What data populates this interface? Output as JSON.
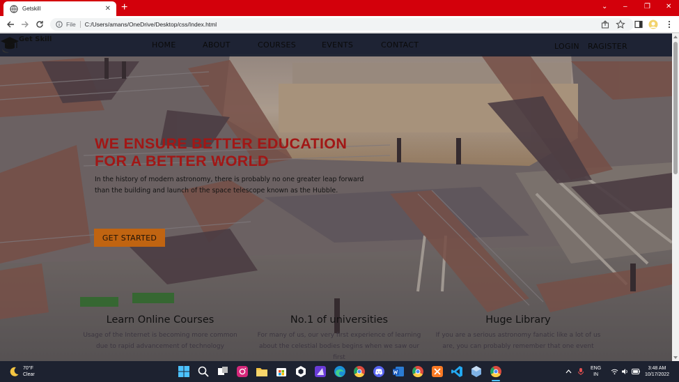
{
  "browser": {
    "tab_title": "Getskill",
    "tab_close": "✕",
    "new_tab": "+",
    "minimize": "⌄",
    "window_min": "–",
    "window_max": "❐",
    "window_close": "✕",
    "url_scheme": "File",
    "url": "C:/Users/amans/OneDrive/Desktop/css/Index.html"
  },
  "site": {
    "brand": "Get Skill",
    "nav": [
      "HOME",
      "ABOUT",
      "COURSES",
      "EVENTS",
      "CONTACT"
    ],
    "login": "LOGIN",
    "register": "RAGISTER",
    "hero_line1": "WE ENSURE BETTER EDUCATION",
    "hero_line2": "FOR A BETTER WORLD",
    "hero_sub1": "In the history of modern astronomy, there is probably no one greater leap forward",
    "hero_sub2": "than the building and launch of the space telescope known as the Hubble.",
    "cta": "GET STARTED",
    "features": [
      {
        "title": "Learn Online Courses",
        "desc": "Usage of the Internet is becoming more common due to rapid advancement of technology"
      },
      {
        "title": "No.1 of universities",
        "desc": "For many of us, our very first experience of learning about the celestial bodies begins when we saw our first"
      },
      {
        "title": "Huge Library",
        "desc": "If you are a serious astronomy fanatic like a lot of us are, you can probably remember that one event"
      }
    ]
  },
  "taskbar": {
    "temp": "70°F",
    "weather": "Clear",
    "lang1": "ENG",
    "lang2": "IN",
    "time": "3:48 AM",
    "date": "10/17/2022"
  },
  "colors": {
    "tabbar": "#d3000b",
    "hero_title": "#a11716",
    "cta_bg": "#c06411",
    "nav_strip": "#181e30"
  }
}
